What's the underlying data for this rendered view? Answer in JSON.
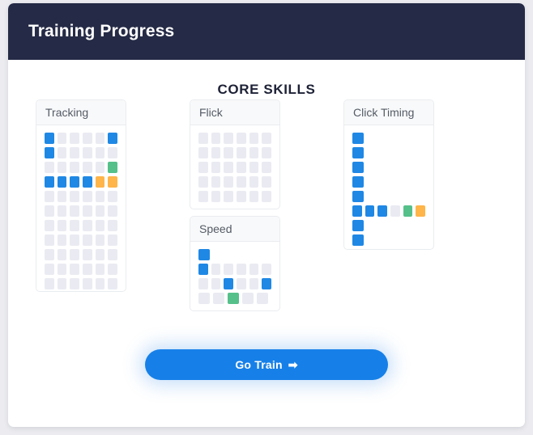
{
  "header": {
    "title": "Training Progress",
    "bg_color": "#252a46"
  },
  "main": {
    "section_title": "CORE SKILLS",
    "legend_colors": {
      "filled": "#1f88e5",
      "good": "#55c08a",
      "warn": "#ffb549",
      "empty": "#eaebf2"
    },
    "panels": [
      {
        "name": "tracking",
        "label": "Tracking",
        "columns": 6,
        "rows": [
          [
            "blue",
            "empty",
            "empty",
            "empty",
            "empty",
            "blue"
          ],
          [
            "blue",
            "empty",
            "empty",
            "empty",
            "empty",
            "empty"
          ],
          [
            "empty",
            "empty",
            "empty",
            "empty",
            "empty",
            "green"
          ],
          [
            "blue",
            "blue",
            "blue",
            "blue",
            "orange",
            "orange"
          ],
          [
            "empty",
            "empty",
            "empty",
            "empty",
            "empty",
            "empty"
          ],
          [
            "empty",
            "empty",
            "empty",
            "empty",
            "empty",
            "empty"
          ],
          [
            "empty",
            "empty",
            "empty",
            "empty",
            "empty",
            "empty"
          ],
          [
            "empty",
            "empty",
            "empty",
            "empty",
            "empty",
            "empty"
          ],
          [
            "empty",
            "empty",
            "empty",
            "empty",
            "empty",
            "empty"
          ],
          [
            "empty",
            "empty",
            "empty",
            "empty",
            "empty",
            "empty"
          ],
          [
            "empty",
            "empty",
            "empty",
            "empty",
            "empty",
            "empty"
          ]
        ]
      },
      {
        "name": "flick",
        "label": "Flick",
        "columns": 6,
        "rows": [
          [
            "empty",
            "empty",
            "empty",
            "empty",
            "empty",
            "empty"
          ],
          [
            "empty",
            "empty",
            "empty",
            "empty",
            "empty",
            "empty"
          ],
          [
            "empty",
            "empty",
            "empty",
            "empty",
            "empty",
            "empty"
          ],
          [
            "empty",
            "empty",
            "empty",
            "empty",
            "empty",
            "empty"
          ],
          [
            "empty",
            "empty",
            "empty",
            "empty",
            "empty",
            "empty"
          ]
        ]
      },
      {
        "name": "speed",
        "label": "Speed",
        "columns": 6,
        "rows": [
          [
            "blue"
          ],
          [
            "blue",
            "empty",
            "empty",
            "empty",
            "empty",
            "empty"
          ],
          [
            "empty",
            "empty",
            "blue",
            "empty",
            "empty",
            "blue"
          ],
          [
            "empty",
            "empty",
            "green",
            "empty",
            "empty"
          ]
        ]
      },
      {
        "name": "click-timing",
        "label": "Click Timing",
        "columns": 6,
        "rows": [
          [
            "blue"
          ],
          [
            "blue"
          ],
          [
            "blue"
          ],
          [
            "blue"
          ],
          [
            "blue"
          ],
          [
            "blue",
            "blue",
            "blue",
            "empty",
            "green",
            "orange"
          ],
          [
            "blue"
          ],
          [
            "blue"
          ]
        ]
      }
    ]
  },
  "cta": {
    "label": "Go Train",
    "arrow_icon": "➡"
  }
}
